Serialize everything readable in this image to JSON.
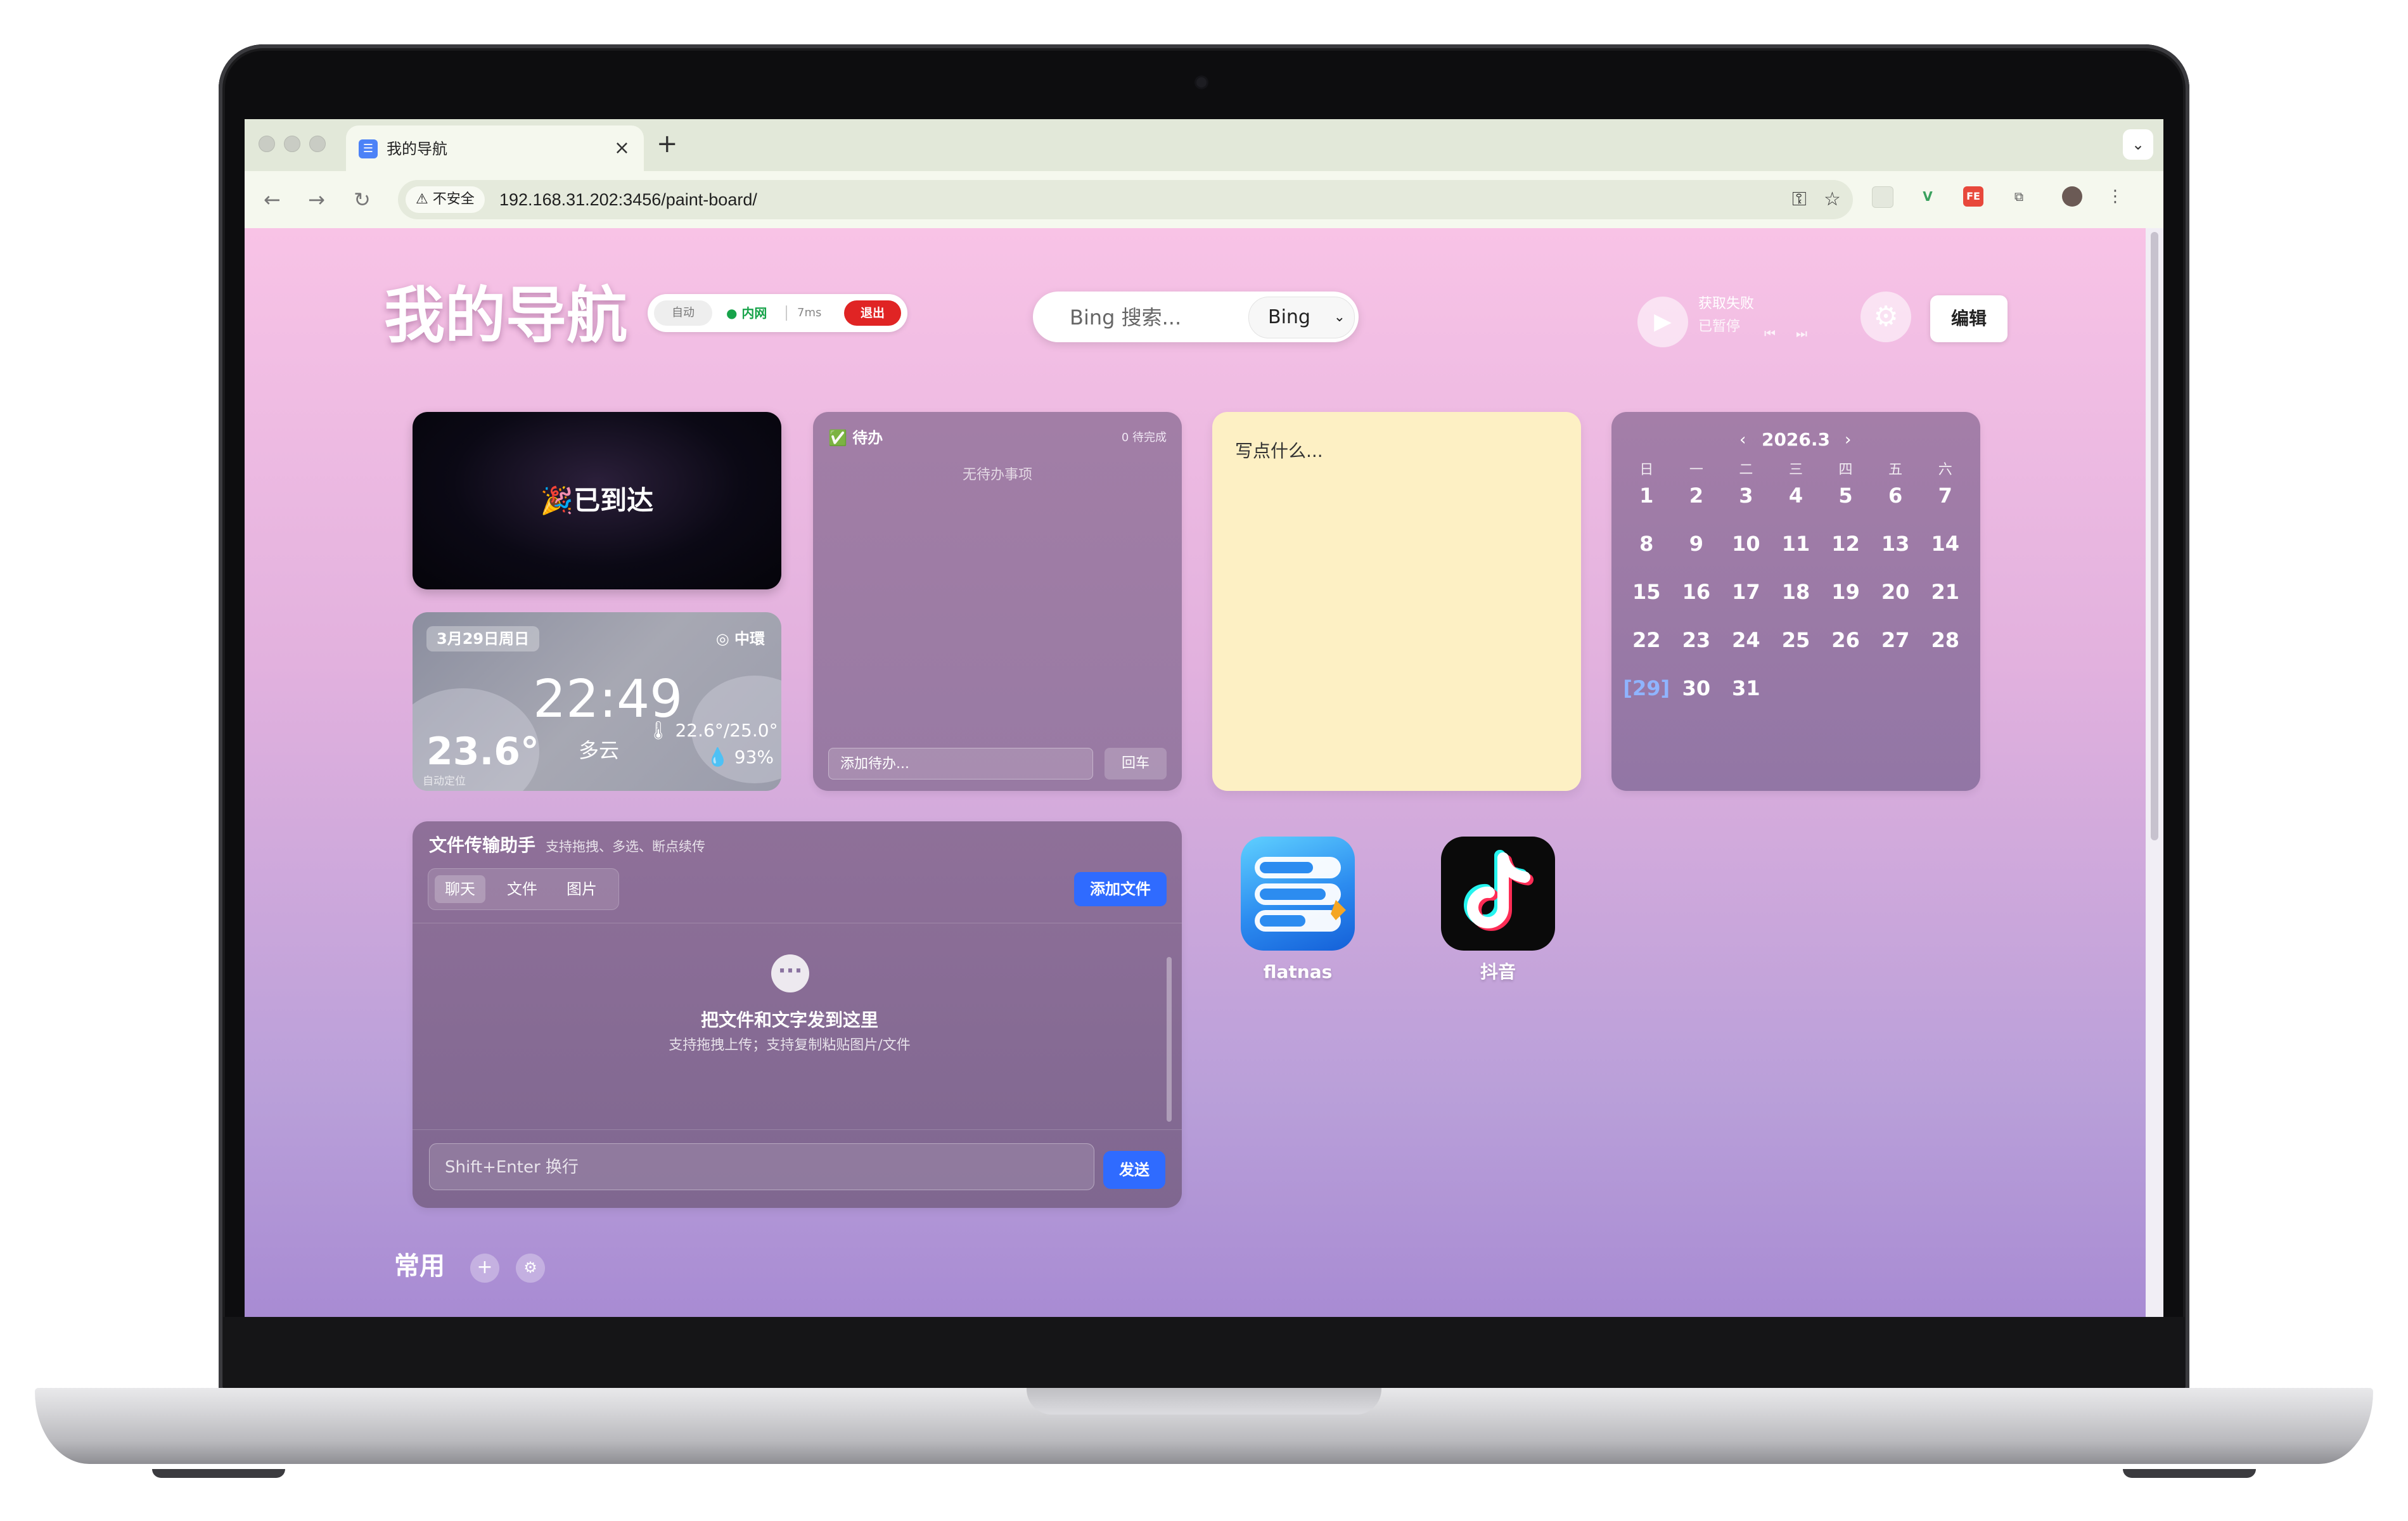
{
  "browser": {
    "tab_title": "我的导航",
    "tab_favicon": "☰",
    "tab_close": "×",
    "new_tab": "+",
    "tab_menu": "⌄",
    "nav": {
      "back": "←",
      "forward": "→",
      "reload": "↻"
    },
    "security_label": "⚠ 不安全",
    "url": "192.168.31.202:3456/paint-board/",
    "omnibox_icons": {
      "password": "⚿",
      "bookmark": "☆"
    },
    "toolbar_icons": {
      "extensions": "⧉",
      "menu": "⋮"
    }
  },
  "header": {
    "title": "我的导航",
    "status": {
      "mode": "自动",
      "network": "● 内网",
      "latency": "7ms",
      "exit": "退出"
    },
    "search": {
      "placeholder": "Bing 搜索...",
      "engine": "Bing"
    },
    "player": {
      "status": "获取失败",
      "state": "已暂停",
      "play_icon": "▶",
      "prev_icon": "⏮",
      "next_icon": "⏭"
    },
    "settings_icon": "⚙",
    "edit_label": "编辑"
  },
  "arrival_card": {
    "text": "🎉已到达"
  },
  "weather": {
    "date": "3月29日周日",
    "location": "◎ 中環",
    "time": "22:49",
    "temperature": "23.6°",
    "auto_locate": "自动定位",
    "condition": "多云",
    "range": "🌡 22.6°/25.0°",
    "humidity": "💧 93%"
  },
  "todo": {
    "title": "✅ 待办",
    "count": "0 待完成",
    "empty": "无待办事项",
    "placeholder": "添加待办...",
    "submit": "回车"
  },
  "note": {
    "placeholder": "写点什么..."
  },
  "calendar": {
    "title": "2026.3",
    "prev": "‹",
    "next": "›",
    "weekdays": [
      "日",
      "一",
      "二",
      "三",
      "四",
      "五",
      "六"
    ],
    "days": [
      "1",
      "2",
      "3",
      "4",
      "5",
      "6",
      "7",
      "8",
      "9",
      "10",
      "11",
      "12",
      "13",
      "14",
      "15",
      "16",
      "17",
      "18",
      "19",
      "20",
      "21",
      "22",
      "23",
      "24",
      "25",
      "26",
      "27",
      "28",
      "[29]",
      "30",
      "31"
    ],
    "today": "[29]",
    "today_color": "#8fb4ff"
  },
  "file_transfer": {
    "title": "文件传输助手",
    "subtitle": "支持拖拽、多选、断点续传",
    "tabs": [
      "聊天",
      "文件",
      "图片"
    ],
    "active_tab": "聊天",
    "add_file": "添加文件",
    "empty_icon": "···",
    "empty_title": "把文件和文字发到这里",
    "empty_hint": "支持拖拽上传；支持复制粘贴图片/文件",
    "input_placeholder": "Shift+Enter 换行",
    "send": "发送",
    "accent": "#2f6bff"
  },
  "apps": [
    {
      "name": "flatnas",
      "icon": "flatnas-icon"
    },
    {
      "name": "抖音",
      "icon": "douyin-icon"
    }
  ],
  "section": {
    "title": "常用",
    "add_icon": "+",
    "settings_icon": "⚙"
  }
}
